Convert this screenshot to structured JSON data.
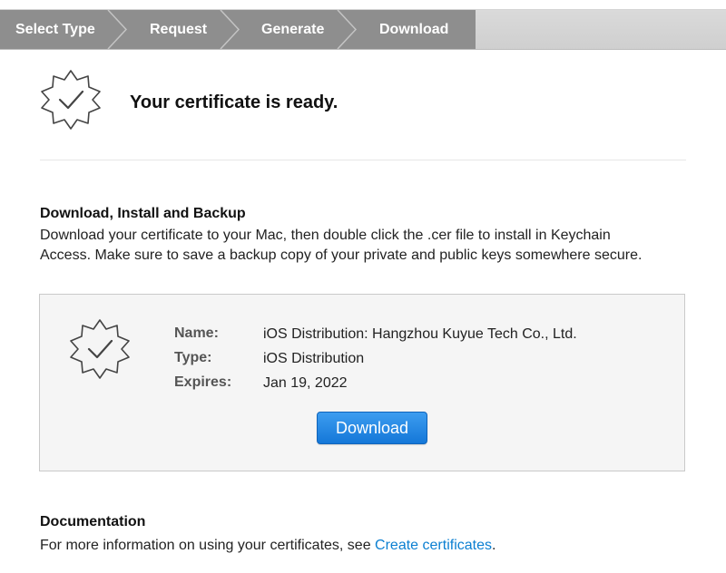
{
  "steps": [
    {
      "label": "Select Type"
    },
    {
      "label": "Request"
    },
    {
      "label": "Generate"
    },
    {
      "label": "Download"
    }
  ],
  "hero": {
    "title": "Your certificate is ready.",
    "icon": "certificate-badge-icon"
  },
  "download_section": {
    "heading": "Download, Install and Backup",
    "line1": "Download your certificate to your Mac, then double click the .cer file to install in Keychain",
    "line2": "Access. Make sure to save a backup copy of your private and public keys somewhere secure."
  },
  "certificate": {
    "name_label": "Name:",
    "name_value": "iOS Distribution: Hangzhou Kuyue Tech Co., Ltd.",
    "type_label": "Type:",
    "type_value": "iOS Distribution",
    "expires_label": "Expires:",
    "expires_value": "Jan 19, 2022",
    "download_label": "Download"
  },
  "documentation": {
    "heading": "Documentation",
    "text_before": "For more information on using your certificates, see ",
    "link": "Create certificates",
    "text_after": "."
  },
  "colors": {
    "step_active": "#8e8e8e",
    "link": "#0b7fd1",
    "button": "#1477d8"
  }
}
